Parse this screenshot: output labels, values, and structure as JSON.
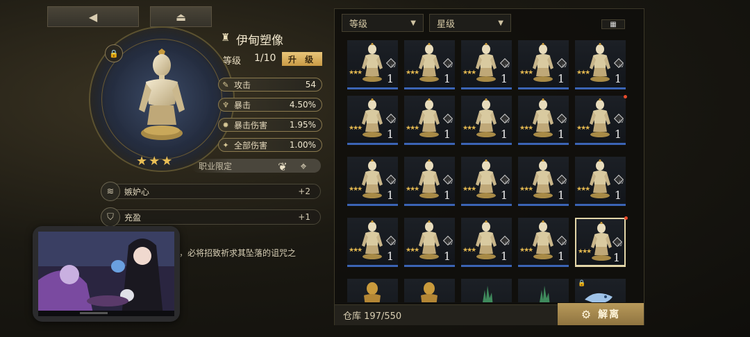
{
  "nav": {
    "back_icon": "back-arrow-icon",
    "eject_icon": "eject-icon"
  },
  "item": {
    "name": "伊甸塑像",
    "level_label": "等级",
    "level_value": "1/10",
    "upgrade_label": "升 级",
    "stars": 3,
    "stats": [
      {
        "label": "攻击",
        "value": "54",
        "icon": "sword-icon"
      },
      {
        "label": "暴击",
        "value": "4.50%",
        "icon": "crit-icon"
      },
      {
        "label": "暴击伤害",
        "value": "1.95%",
        "icon": "crit-damage-icon"
      },
      {
        "label": "全部伤害",
        "value": "1.00%",
        "icon": "all-damage-icon"
      }
    ],
    "class_limit_label": "职业限定"
  },
  "skills": [
    {
      "name": "嫉妒心",
      "value": "+2"
    },
    {
      "name": "充盈",
      "value": "+1"
    }
  ],
  "description": "，必将招致祈求其坠落的诅咒之",
  "filters": {
    "level": "等级",
    "star": "星级"
  },
  "inventory": {
    "cell_level": "1",
    "cell_lv_label": "LV",
    "warehouse_label": "仓库 197/550",
    "dismantle_label": "解离"
  },
  "colors": {
    "accent_gold": "#e9c67a",
    "rarity_blue": "#3b64b5",
    "new_dot": "#e84b2c"
  }
}
